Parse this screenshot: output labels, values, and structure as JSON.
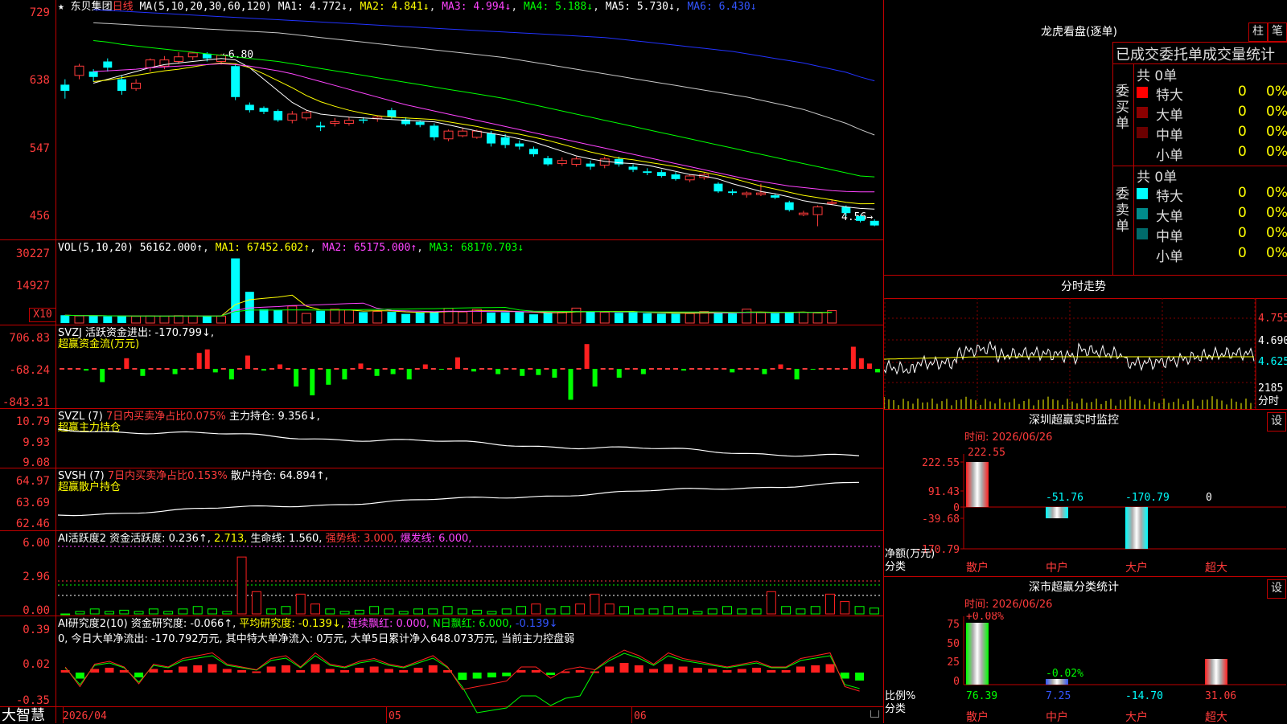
{
  "header": {
    "stock_name": "东贝集团",
    "period": "日线",
    "ma_label": "MA(5,10,20,30,60,120)",
    "ma1": "MA1: 4.772↓",
    "ma2": "MA2: 4.841↓",
    "ma3": "MA3: 4.994↓",
    "ma4": "MA4: 5.188↓",
    "ma5": "MA5: 5.730↓",
    "ma6": "MA6: 6.430↓",
    "high_mark": "6.80",
    "low_mark": "4.56"
  },
  "price_axis": [
    "729",
    "638",
    "547",
    "456"
  ],
  "vol": {
    "label": "VOL(5,10,20)",
    "val": "56162.000↑",
    "ma1": "MA1: 67452.602↑",
    "ma2": "MA2: 65175.000↑",
    "ma3": "MA3: 68170.703↓",
    "axis": [
      "30227",
      "14927"
    ],
    "unit": "X10"
  },
  "svzj": {
    "label": "SVZJ  活跃资金进出: -170.799↓,",
    "sub": "超赢资金流(万元)",
    "axis": [
      "706.83",
      "-68.24",
      "-843.31"
    ]
  },
  "svzl": {
    "label": "SVZL (7)",
    "red": "7日内买卖净占比0.075%",
    "main": "主力持仓: 9.356↓,",
    "sub": "超赢主力持仓",
    "axis": [
      "10.79",
      "9.93",
      "9.08"
    ]
  },
  "svsh": {
    "label": "SVSH (7)",
    "red": "7日内买卖净占比0.153%",
    "main": "散户持仓: 64.894↑,",
    "sub": "超赢散户持仓",
    "axis": [
      "64.97",
      "63.69",
      "62.46"
    ]
  },
  "ai1": {
    "label": "AI活跃度2",
    "a": "资金活跃度: 0.236↑,",
    "b": "2.713,",
    "c": "生命线: 1.560,",
    "d": "强势线: 3.000,",
    "e": "爆发线: 6.000,",
    "axis": [
      "6.00",
      "2.96",
      "0.00"
    ]
  },
  "ai2": {
    "label": "AI研究度2(10)",
    "a": "资金研究度: -0.066↑,",
    "b": "平均研究度: -0.139↓,",
    "c": "连续飘红: 0.000,",
    "d": "N日飘红: 6.000,",
    "e": "-0.139↓",
    "desc": "0, 今日大单净流出: -170.792万元, 其中特大单净流入: 0万元, 大单5日累计净入648.073万元, 当前主力控盘弱",
    "axis": [
      "0.39",
      "0.02",
      "-0.35"
    ]
  },
  "bottom": {
    "brand": "大智慧",
    "date": "2026/04",
    "m05": "05",
    "m06": "06"
  },
  "right": {
    "lhb_title": "龙虎看盘(逐单)",
    "btn_zhu": "柱",
    "btn_bi": "笔",
    "stat_title": "已成交委托单成交量统计",
    "buy_label": "委买单",
    "sell_label": "委卖单",
    "buy_total": "共 0单",
    "sell_total": "共 0单",
    "buy_rows": [
      {
        "name": "特大",
        "val": "0",
        "pct": "0%",
        "color": "#ff0000"
      },
      {
        "name": "大单",
        "val": "0",
        "pct": "0%",
        "color": "#8b0000"
      },
      {
        "name": "中单",
        "val": "0",
        "pct": "0%",
        "color": "#6b0000"
      },
      {
        "name": "小单",
        "val": "0",
        "pct": "0%",
        "color": ""
      }
    ],
    "sell_rows": [
      {
        "name": "特大",
        "val": "0",
        "pct": "0%",
        "color": "#00ffff"
      },
      {
        "name": "大单",
        "val": "0",
        "pct": "0%",
        "color": "#008b8b"
      },
      {
        "name": "中单",
        "val": "0",
        "pct": "0%",
        "color": "#006b6b"
      },
      {
        "name": "小单",
        "val": "0",
        "pct": "0%",
        "color": ""
      }
    ],
    "intraday_title": "分时走势",
    "intraday_axis": [
      "4.755",
      "4.690",
      "4.625"
    ],
    "intraday_vol": "2185",
    "intraday_unit": "分时",
    "sz_title": "深圳超赢实时监控",
    "sz_btn": "设",
    "sz_time": "时间: 2026/06/26",
    "sz_axis": [
      "222.55",
      "91.43",
      "0",
      "-39.68",
      "-170.79"
    ],
    "sz_values": [
      "222.55",
      "-51.76",
      "-170.79",
      "0"
    ],
    "sz_unit": "净额(万元)",
    "sz_cat_label": "分类",
    "sz_cats": [
      "散户",
      "中户",
      "大户",
      "超大"
    ],
    "cls_title": "深市超赢分类统计",
    "cls_btn": "设",
    "cls_time": "时间: 2026/06/26",
    "cls_top": "+0.08%",
    "cls_mid": "-0.02%",
    "cls_axis": [
      "75",
      "50",
      "25",
      "0"
    ],
    "cls_values": [
      "76.39",
      "7.25",
      "-14.70",
      "31.06"
    ],
    "cls_unit": "比例%",
    "cls_cat_label": "分类",
    "cls_cats": [
      "散户",
      "中户",
      "大户",
      "超大"
    ]
  },
  "chart_data": {
    "type": "candlestick",
    "candles": [
      {
        "o": 6.38,
        "c": 6.3,
        "h": 6.45,
        "l": 6.2
      },
      {
        "o": 6.5,
        "c": 6.62,
        "h": 6.65,
        "l": 6.45
      },
      {
        "o": 6.55,
        "c": 6.48,
        "h": 6.58,
        "l": 6.42
      },
      {
        "o": 6.68,
        "c": 6.6,
        "h": 6.72,
        "l": 6.55
      },
      {
        "o": 6.45,
        "c": 6.3,
        "h": 6.5,
        "l": 6.25
      },
      {
        "o": 6.33,
        "c": 6.4,
        "h": 6.45,
        "l": 6.3
      },
      {
        "o": 6.6,
        "c": 6.7,
        "h": 6.72,
        "l": 6.55
      },
      {
        "o": 6.62,
        "c": 6.7,
        "h": 6.75,
        "l": 6.58
      },
      {
        "o": 6.68,
        "c": 6.74,
        "h": 6.8,
        "l": 6.65
      },
      {
        "o": 6.74,
        "c": 6.79,
        "h": 6.8,
        "l": 6.7
      },
      {
        "o": 6.78,
        "c": 6.72,
        "h": 6.8,
        "l": 6.68
      },
      {
        "o": 6.68,
        "c": 6.76,
        "h": 6.78,
        "l": 6.64
      },
      {
        "o": 6.62,
        "c": 6.22,
        "h": 6.65,
        "l": 6.18
      },
      {
        "o": 6.12,
        "c": 6.05,
        "h": 6.15,
        "l": 6.02
      },
      {
        "o": 6.08,
        "c": 6.03,
        "h": 6.1,
        "l": 6.0
      },
      {
        "o": 6.04,
        "c": 5.92,
        "h": 6.06,
        "l": 5.9
      },
      {
        "o": 5.92,
        "c": 6.0,
        "h": 6.04,
        "l": 5.88
      },
      {
        "o": 5.95,
        "c": 6.02,
        "h": 6.05,
        "l": 5.92
      },
      {
        "o": 5.85,
        "c": 5.83,
        "h": 5.9,
        "l": 5.78
      },
      {
        "o": 5.88,
        "c": 5.9,
        "h": 5.95,
        "l": 5.84
      },
      {
        "o": 5.88,
        "c": 5.92,
        "h": 5.96,
        "l": 5.85
      },
      {
        "o": 5.93,
        "c": 5.92,
        "h": 5.96,
        "l": 5.88
      },
      {
        "o": 5.94,
        "c": 5.96,
        "h": 5.98,
        "l": 5.9
      },
      {
        "o": 6.05,
        "c": 5.96,
        "h": 6.08,
        "l": 5.94
      },
      {
        "o": 5.93,
        "c": 5.87,
        "h": 5.96,
        "l": 5.85
      },
      {
        "o": 5.9,
        "c": 5.86,
        "h": 5.92,
        "l": 5.83
      },
      {
        "o": 5.85,
        "c": 5.7,
        "h": 5.88,
        "l": 5.66
      },
      {
        "o": 5.68,
        "c": 5.78,
        "h": 5.8,
        "l": 5.65
      },
      {
        "o": 5.72,
        "c": 5.78,
        "h": 5.82,
        "l": 5.7
      },
      {
        "o": 5.7,
        "c": 5.78,
        "h": 5.8,
        "l": 5.68
      },
      {
        "o": 5.75,
        "c": 5.62,
        "h": 5.78,
        "l": 5.58
      },
      {
        "o": 5.7,
        "c": 5.6,
        "h": 5.74,
        "l": 5.56
      },
      {
        "o": 5.62,
        "c": 5.58,
        "h": 5.66,
        "l": 5.54
      },
      {
        "o": 5.55,
        "c": 5.48,
        "h": 5.58,
        "l": 5.45
      },
      {
        "o": 5.43,
        "c": 5.35,
        "h": 5.46,
        "l": 5.33
      },
      {
        "o": 5.36,
        "c": 5.4,
        "h": 5.44,
        "l": 5.33
      },
      {
        "o": 5.35,
        "c": 5.42,
        "h": 5.45,
        "l": 5.32
      },
      {
        "o": 5.36,
        "c": 5.32,
        "h": 5.4,
        "l": 5.28
      },
      {
        "o": 5.34,
        "c": 5.42,
        "h": 5.45,
        "l": 5.3
      },
      {
        "o": 5.42,
        "c": 5.35,
        "h": 5.45,
        "l": 5.32
      },
      {
        "o": 5.32,
        "c": 5.28,
        "h": 5.35,
        "l": 5.25
      },
      {
        "o": 5.26,
        "c": 5.24,
        "h": 5.3,
        "l": 5.21
      },
      {
        "o": 5.25,
        "c": 5.2,
        "h": 5.28,
        "l": 5.18
      },
      {
        "o": 5.22,
        "c": 5.16,
        "h": 5.25,
        "l": 5.14
      },
      {
        "o": 5.15,
        "c": 5.2,
        "h": 5.22,
        "l": 5.12
      },
      {
        "o": 5.18,
        "c": 5.22,
        "h": 5.24,
        "l": 5.15
      },
      {
        "o": 5.1,
        "c": 5.0,
        "h": 5.12,
        "l": 4.98
      },
      {
        "o": 5.0,
        "c": 4.98,
        "h": 5.03,
        "l": 4.95
      },
      {
        "o": 4.96,
        "c": 4.98,
        "h": 5.0,
        "l": 4.92
      },
      {
        "o": 4.96,
        "c": 4.98,
        "h": 5.1,
        "l": 4.94
      },
      {
        "o": 4.95,
        "c": 4.92,
        "h": 4.97,
        "l": 4.9
      },
      {
        "o": 4.86,
        "c": 4.76,
        "h": 4.88,
        "l": 4.74
      },
      {
        "o": 4.7,
        "c": 4.72,
        "h": 4.75,
        "l": 4.68
      },
      {
        "o": 4.7,
        "c": 4.8,
        "h": 4.82,
        "l": 4.55
      },
      {
        "o": 4.85,
        "c": 4.86,
        "h": 4.9,
        "l": 4.82
      },
      {
        "o": 4.8,
        "c": 4.72,
        "h": 4.82,
        "l": 4.68
      },
      {
        "o": 4.68,
        "c": 4.62,
        "h": 4.7,
        "l": 4.6
      },
      {
        "o": 4.62,
        "c": 4.56,
        "h": 4.64,
        "l": 4.55
      }
    ],
    "ma_series": [
      {
        "name": "MA1",
        "color": "#ffffff",
        "values": [
          6.4,
          6.45,
          6.5,
          6.55,
          6.6,
          6.64,
          6.66,
          6.68,
          6.7,
          6.72,
          6.7,
          6.6,
          6.45,
          6.3,
          6.15,
          6.05,
          6.0,
          5.98,
          5.96,
          5.95,
          5.94,
          5.93,
          5.92,
          5.91,
          5.9,
          5.86,
          5.82,
          5.78,
          5.75,
          5.72,
          5.68,
          5.64,
          5.58,
          5.52,
          5.46,
          5.42,
          5.39,
          5.37,
          5.36,
          5.34,
          5.3,
          5.26,
          5.22,
          5.2,
          5.16,
          5.1,
          5.05,
          5.0,
          4.97,
          4.93,
          4.88,
          4.85,
          4.83,
          4.8,
          4.78,
          4.772
        ]
      },
      {
        "name": "MA2",
        "color": "#ffff00",
        "values": [
          6.42,
          6.44,
          6.47,
          6.5,
          6.53,
          6.56,
          6.58,
          6.61,
          6.64,
          6.66,
          6.65,
          6.6,
          6.52,
          6.43,
          6.34,
          6.24,
          6.16,
          6.1,
          6.05,
          6.01,
          5.98,
          5.96,
          5.95,
          5.94,
          5.93,
          5.9,
          5.87,
          5.84,
          5.8,
          5.77,
          5.74,
          5.7,
          5.66,
          5.61,
          5.56,
          5.51,
          5.47,
          5.43,
          5.41,
          5.38,
          5.35,
          5.32,
          5.28,
          5.25,
          5.21,
          5.17,
          5.12,
          5.07,
          5.03,
          4.99,
          4.95,
          4.92,
          4.89,
          4.86,
          4.84,
          4.841
        ]
      },
      {
        "name": "MA3",
        "color": "#ff44ff",
        "values": [
          6.55,
          6.56,
          6.57,
          6.58,
          6.6,
          6.61,
          6.62,
          6.63,
          6.64,
          6.65,
          6.64,
          6.62,
          6.59,
          6.56,
          6.52,
          6.47,
          6.42,
          6.37,
          6.32,
          6.27,
          6.22,
          6.17,
          6.12,
          6.08,
          6.04,
          6.0,
          5.96,
          5.92,
          5.88,
          5.84,
          5.8,
          5.76,
          5.72,
          5.68,
          5.64,
          5.6,
          5.56,
          5.52,
          5.48,
          5.44,
          5.4,
          5.36,
          5.32,
          5.28,
          5.24,
          5.2,
          5.16,
          5.13,
          5.1,
          5.07,
          5.05,
          5.03,
          5.01,
          5.0,
          4.995,
          4.994
        ]
      },
      {
        "name": "MA4",
        "color": "#00ff00",
        "values": [
          6.95,
          6.93,
          6.9,
          6.88,
          6.86,
          6.84,
          6.82,
          6.8,
          6.78,
          6.76,
          6.74,
          6.72,
          6.7,
          6.68,
          6.65,
          6.62,
          6.59,
          6.56,
          6.53,
          6.5,
          6.47,
          6.44,
          6.41,
          6.38,
          6.35,
          6.32,
          6.29,
          6.26,
          6.23,
          6.2,
          6.16,
          6.12,
          6.08,
          6.04,
          6.0,
          5.96,
          5.92,
          5.88,
          5.84,
          5.8,
          5.76,
          5.72,
          5.68,
          5.64,
          5.6,
          5.56,
          5.52,
          5.48,
          5.44,
          5.4,
          5.36,
          5.32,
          5.28,
          5.24,
          5.2,
          5.188
        ]
      },
      {
        "name": "MA5",
        "color": "#c8c8c8",
        "values": [
          7.18,
          7.17,
          7.16,
          7.15,
          7.14,
          7.13,
          7.12,
          7.11,
          7.1,
          7.09,
          7.08,
          7.07,
          7.06,
          7.05,
          7.03,
          7.01,
          6.99,
          6.97,
          6.95,
          6.93,
          6.91,
          6.89,
          6.87,
          6.85,
          6.83,
          6.81,
          6.79,
          6.77,
          6.75,
          6.73,
          6.7,
          6.67,
          6.64,
          6.61,
          6.58,
          6.55,
          6.52,
          6.49,
          6.46,
          6.43,
          6.4,
          6.37,
          6.34,
          6.31,
          6.28,
          6.25,
          6.22,
          6.18,
          6.14,
          6.1,
          6.06,
          6.0,
          5.94,
          5.88,
          5.8,
          5.73
        ]
      },
      {
        "name": "MA6",
        "color": "#2233ff",
        "values": [
          7.35,
          7.34,
          7.33,
          7.32,
          7.31,
          7.3,
          7.29,
          7.28,
          7.27,
          7.26,
          7.25,
          7.24,
          7.23,
          7.22,
          7.21,
          7.2,
          7.19,
          7.18,
          7.17,
          7.16,
          7.15,
          7.14,
          7.13,
          7.12,
          7.11,
          7.1,
          7.09,
          7.08,
          7.07,
          7.06,
          7.05,
          7.04,
          7.03,
          7.02,
          7.01,
          7.0,
          6.99,
          6.97,
          6.95,
          6.93,
          6.91,
          6.89,
          6.87,
          6.85,
          6.83,
          6.81,
          6.78,
          6.75,
          6.72,
          6.69,
          6.66,
          6.62,
          6.58,
          6.54,
          6.48,
          6.43
        ]
      }
    ],
    "price_range": [
      4.4,
      7.35
    ],
    "volumes": [
      3500,
      3200,
      3300,
      3000,
      3100,
      3000,
      3200,
      3100,
      3300,
      3200,
      3000,
      3100,
      29000,
      14000,
      6200,
      5800,
      7600,
      4300,
      5500,
      6200,
      5900,
      4900,
      5200,
      5000,
      4100,
      4700,
      5200,
      6600,
      5000,
      6100,
      4700,
      4800,
      4900,
      3900,
      4700,
      4900,
      6700,
      5000,
      4800,
      4600,
      5000,
      4400,
      4200,
      4200,
      4300,
      5200,
      4600,
      4300,
      6200,
      4600,
      4400,
      4700,
      4800,
      4500,
      5616
    ],
    "vol_range": [
      0,
      31000
    ],
    "svzj": [
      0,
      0,
      0,
      -20,
      0,
      -150,
      0,
      0,
      120,
      0,
      -80,
      0,
      0,
      0,
      -60,
      0,
      0,
      180,
      220,
      -40,
      0,
      -120,
      0,
      150,
      0,
      -20,
      0,
      50,
      0,
      -200,
      0,
      -300,
      0,
      -180,
      0,
      -120,
      0,
      60,
      0,
      -80,
      0,
      -60,
      0,
      -120,
      0,
      50,
      0,
      -10,
      0,
      130,
      0,
      -30,
      0,
      0,
      -60,
      0,
      0,
      -80,
      0,
      -70,
      0,
      -100,
      0,
      -350,
      0,
      280,
      -200,
      0,
      0,
      -100,
      0,
      0,
      -60,
      0,
      0,
      0,
      0,
      -20,
      0,
      0,
      0,
      0,
      0,
      -40,
      0,
      0,
      0,
      -60,
      0,
      50,
      0,
      -120,
      0,
      -10,
      0,
      0,
      0,
      0,
      250,
      120,
      60,
      -40
    ],
    "ai1": [
      0,
      0.1,
      0.2,
      0.1,
      0.15,
      0.1,
      0.2,
      0.1,
      0.2,
      0.3,
      0.2,
      0.1,
      2.3,
      0.9,
      0.2,
      0.3,
      0.8,
      0.4,
      0.2,
      0.1,
      0.15,
      0.3,
      0.2,
      0.1,
      0.2,
      0.2,
      0.3,
      0.2,
      0.15,
      0.1,
      0.2,
      0.3,
      0.4,
      0.2,
      0.3,
      0.4,
      0.8,
      0.4,
      0.3,
      0.2,
      0.2,
      0.3,
      0.2,
      0.1,
      0.2,
      0.3,
      0.2,
      0.2,
      0.9,
      0.3,
      0.2,
      0.3,
      0.8,
      0.5,
      0.3,
      0.236
    ],
    "ai2": [
      0.02,
      -0.05,
      0.03,
      0.04,
      0.02,
      -0.04,
      0.03,
      0.02,
      0.05,
      0.06,
      0.07,
      0.03,
      0.02,
      0.01,
      0.05,
      0.06,
      0.02,
      0.07,
      0.03,
      0.02,
      0.04,
      0.05,
      0.03,
      0.02,
      0.04,
      0.06,
      0.02,
      -0.06,
      -0.05,
      -0.04,
      -0.03,
      0.02,
      0.02,
      -0.02,
      0.01,
      0.02,
      0.01,
      0.05,
      0.08,
      0.06,
      0.03,
      0.07,
      0.05,
      0.04,
      0.03,
      0.02,
      0.03,
      0.04,
      0.02,
      0.02,
      0.05,
      0.06,
      0.07,
      -0.05,
      -0.066
    ]
  }
}
